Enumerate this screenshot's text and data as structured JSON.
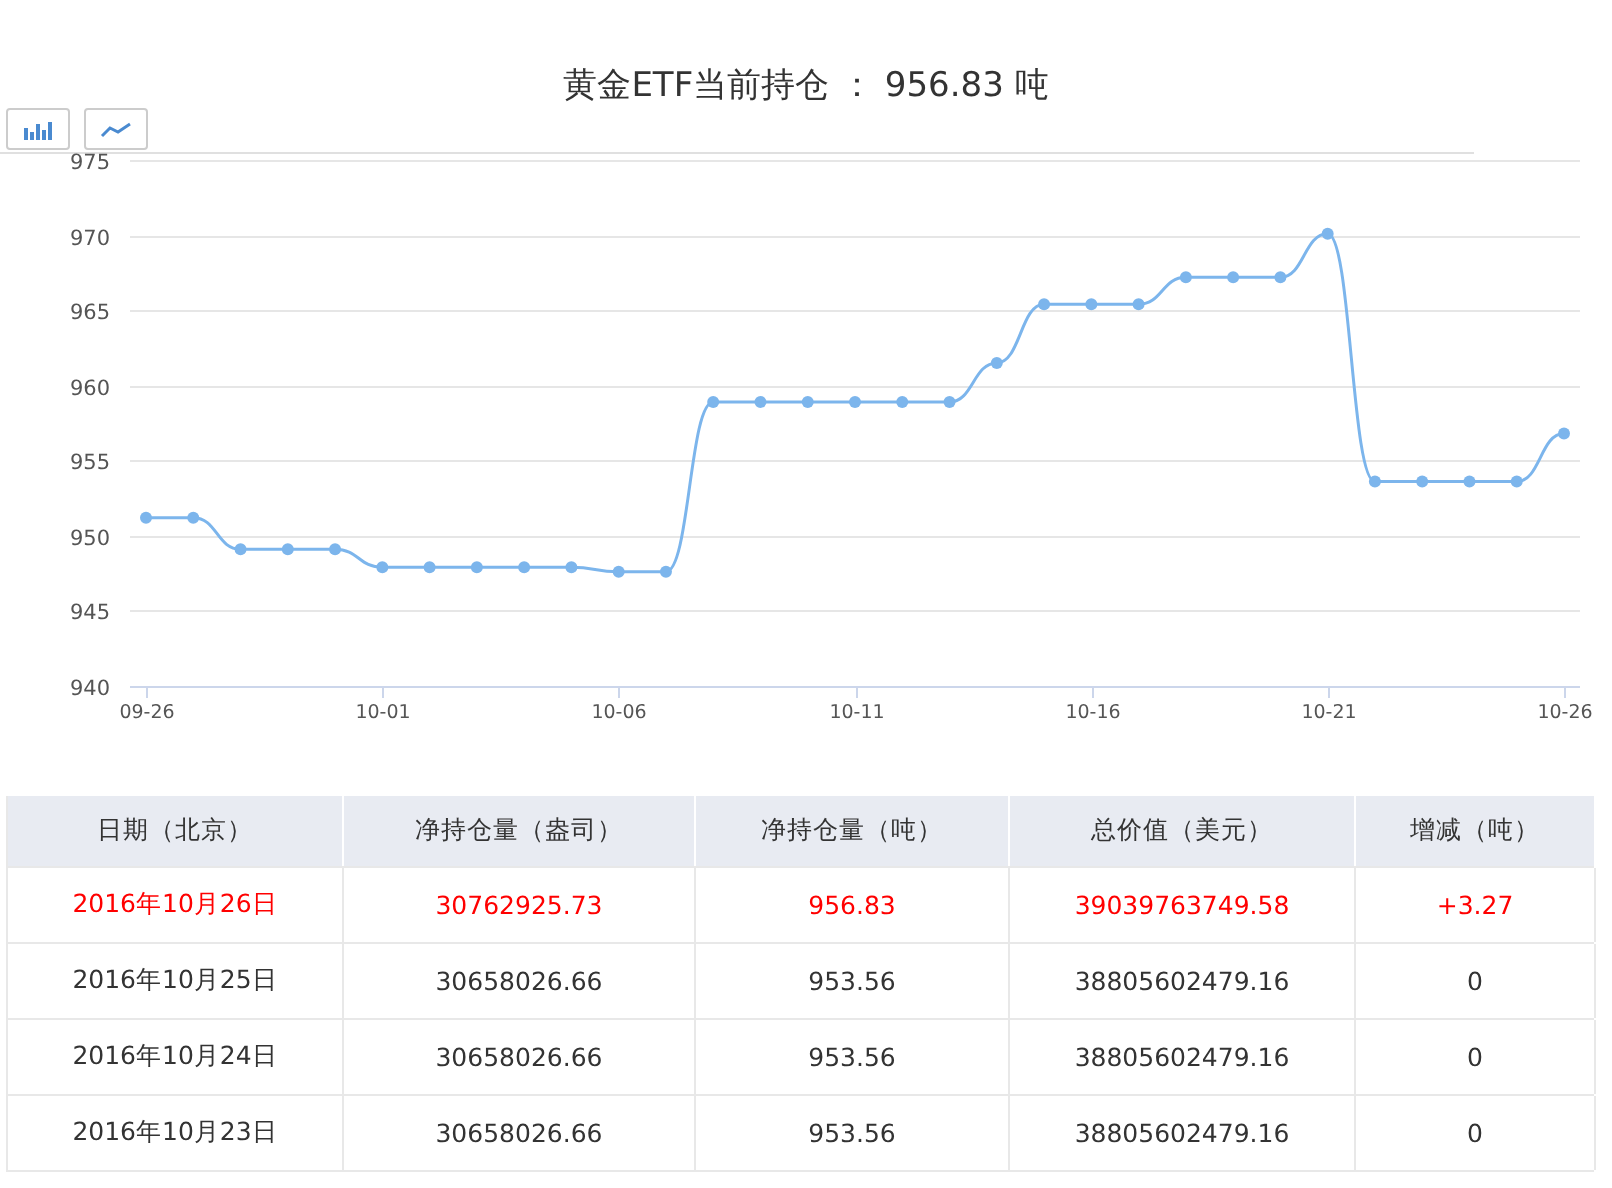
{
  "title": "黄金ETF当前持仓 ： 956.83 吨",
  "toolbar": [
    {
      "kind": "bar"
    },
    {
      "kind": "line"
    }
  ],
  "chart": {
    "chart_data": {
      "type": "line",
      "categories": [
        "09-26",
        null,
        null,
        null,
        null,
        "10-01",
        null,
        null,
        null,
        null,
        "10-06",
        null,
        null,
        null,
        null,
        "10-11",
        null,
        null,
        null,
        null,
        "10-16",
        null,
        null,
        null,
        null,
        "10-21",
        null,
        null,
        null,
        null,
        "10-26"
      ],
      "series": [
        {
          "color": "#7cb5ec",
          "marker": true,
          "values": [
            951.2,
            951.2,
            949.1,
            949.1,
            949.1,
            947.9,
            947.9,
            947.9,
            947.9,
            947.9,
            947.6,
            947.6,
            958.9,
            958.9,
            958.9,
            958.9,
            958.9,
            958.9,
            961.5,
            965.4,
            965.4,
            965.4,
            967.2,
            967.2,
            967.2,
            970.1,
            953.6,
            953.6,
            953.6,
            953.6,
            956.8
          ]
        }
      ],
      "ylim": [
        940,
        975
      ],
      "yticks": [
        940,
        945,
        950,
        955,
        960,
        965,
        970,
        975
      ],
      "grid": true
    }
  },
  "table": {
    "columns": [
      "日期（北京）",
      "净持仓量（盎司）",
      "净持仓量（吨）",
      "总价值（美元）",
      "增减（吨）"
    ],
    "rows": [
      {
        "kind": "increase",
        "cells": [
          "2016年10月26日",
          "30762925.73",
          "956.83",
          "39039763749.58",
          "+3.27"
        ]
      },
      {
        "kind": "unchanged",
        "cells": [
          "2016年10月25日",
          "30658026.66",
          "953.56",
          "38805602479.16",
          "0"
        ]
      },
      {
        "kind": "unchanged",
        "cells": [
          "2016年10月24日",
          "30658026.66",
          "953.56",
          "38805602479.16",
          "0"
        ]
      },
      {
        "kind": "unchanged",
        "cells": [
          "2016年10月23日",
          "30658026.66",
          "953.56",
          "38805602479.16",
          "0"
        ]
      }
    ]
  }
}
